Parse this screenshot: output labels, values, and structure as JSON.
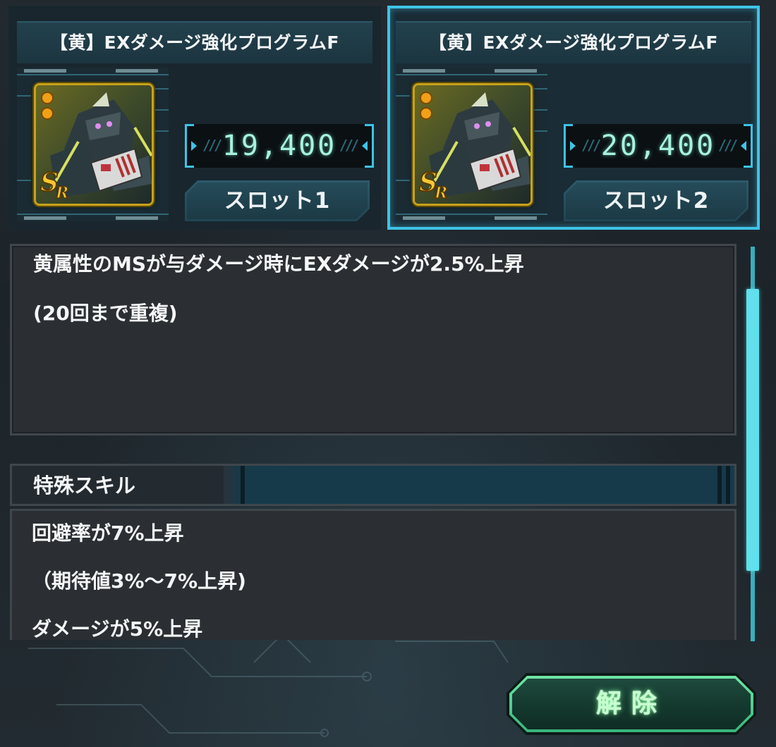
{
  "colors": {
    "accent_cyan": "#3ec3e6",
    "score_text": "#a8f2dd",
    "release_glow": "#6fe7a6",
    "rarity_gold": "#c8a21a"
  },
  "slots": [
    {
      "title": "【黄】EXダメージ強化プログラムF",
      "score": "19,400",
      "slot_label": "スロット1",
      "rarity": "SR",
      "selected": false
    },
    {
      "title": "【黄】EXダメージ強化プログラムF",
      "score": "20,400",
      "slot_label": "スロット2",
      "rarity": "SR",
      "selected": true
    }
  ],
  "description": {
    "lines": [
      "黄属性のMSが与ダメージ時にEXダメージが2.5%上昇",
      "(20回まで重複)"
    ]
  },
  "special_skill": {
    "header": "特殊スキル",
    "lines": [
      "回避率が7%上昇",
      "（期待値3%～7%上昇)",
      "ダメージが5%上昇"
    ]
  },
  "release_button": {
    "label": "解除"
  },
  "icons": [
    "rarity-sr-icon",
    "rank-dot-icon",
    "mobile-suit-portrait",
    "program-chip-icon",
    "score-arrow-icon"
  ]
}
